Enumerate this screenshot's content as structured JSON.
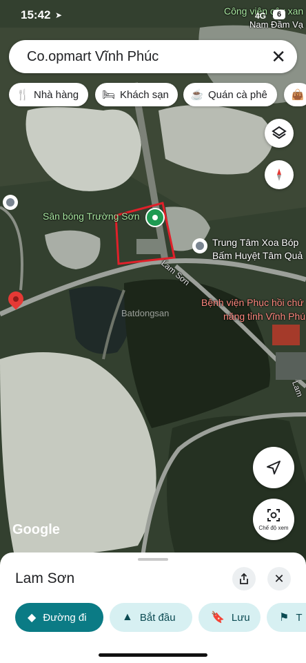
{
  "status": {
    "time": "15:42",
    "network": "4G",
    "battery": "6"
  },
  "search": {
    "query": "Co.opmart Vĩnh Phúc"
  },
  "chips": [
    {
      "label": "Nhà hàng",
      "icon": "restaurant-icon"
    },
    {
      "label": "Khách sạn",
      "icon": "hotel-icon"
    },
    {
      "label": "Quán cà phê",
      "icon": "coffee-icon"
    }
  ],
  "map": {
    "labels": {
      "top_right_1": "Công viên cây xan",
      "top_right_2": "Nam Đầm Vạ",
      "stadium": "Sân bóng Trường Sơn",
      "massage_1": "Trung Tâm Xoa Bóp",
      "massage_2": "Bấm Huyệt Tâm Quả",
      "hospital_1": "Bệnh viện Phục hồi chứ",
      "hospital_2": "năng tỉnh Vĩnh Phú",
      "road": "Lam Sơn",
      "road_right": "Lam",
      "watermark": "Batdongsan"
    },
    "logo": "Google",
    "view_mode_label": "Chế độ xem",
    "colors": {
      "boundary": "#e0202a",
      "selected_pin": "#1e9a52",
      "red_pin": "#e53935"
    }
  },
  "sheet": {
    "title": "Lam Sơn",
    "actions": [
      {
        "label": "Đường đi",
        "icon": "directions-icon"
      },
      {
        "label": "Bắt đầu",
        "icon": "navigation-icon"
      },
      {
        "label": "Lưu",
        "icon": "bookmark-icon"
      },
      {
        "label": "T",
        "icon": "flag-icon"
      }
    ]
  }
}
